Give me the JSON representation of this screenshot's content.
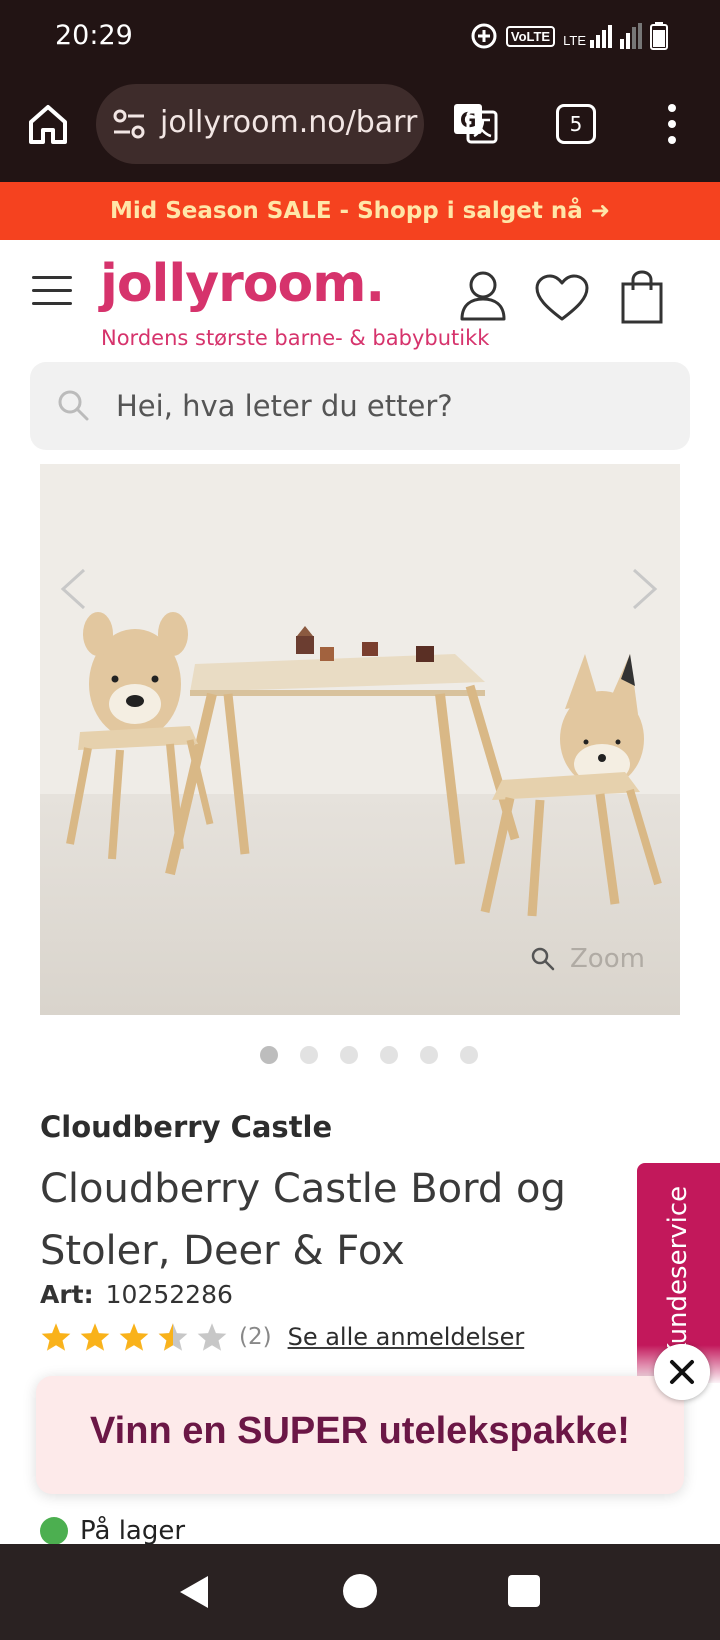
{
  "status_bar": {
    "time": "20:29",
    "icons": [
      "data-saver-icon",
      "volte-icon",
      "lte-signal-icon",
      "roaming-signal-icon",
      "battery-icon"
    ],
    "volte_label": "VoLTE",
    "lte_label": "LTE"
  },
  "browser": {
    "url": "jollyroom.no/barr",
    "tab_count": "5"
  },
  "promo": {
    "text": "Mid Season SALE - Shopp i salget nå ➜"
  },
  "header": {
    "logo": "jollyroom.",
    "tagline": "Nordens største barne- & babybutikk"
  },
  "search": {
    "placeholder": "Hei, hva leter du etter?"
  },
  "gallery": {
    "zoom_label": "Zoom",
    "image_count": 6,
    "active_index": 0
  },
  "product": {
    "brand": "Cloudberry Castle",
    "title": "Cloudberry Castle Bord og Stoler, Deer & Fox",
    "art_label": "Art:",
    "art_number": "10252286",
    "rating": 3.5,
    "rating_max": 5,
    "review_count": "(2)",
    "reviews_link": "Se alle anmeldelser",
    "stock": "På lager"
  },
  "side_tab": {
    "label": "Kundeservice"
  },
  "popup": {
    "text": "Vinn en SUPER utelekspakke!"
  },
  "colors": {
    "brand_pink": "#d6336c",
    "promo_orange": "#f5421f",
    "stock_green": "#4caf50",
    "popup_text": "#6b1746",
    "kundeservice_bg": "#c2185b"
  }
}
